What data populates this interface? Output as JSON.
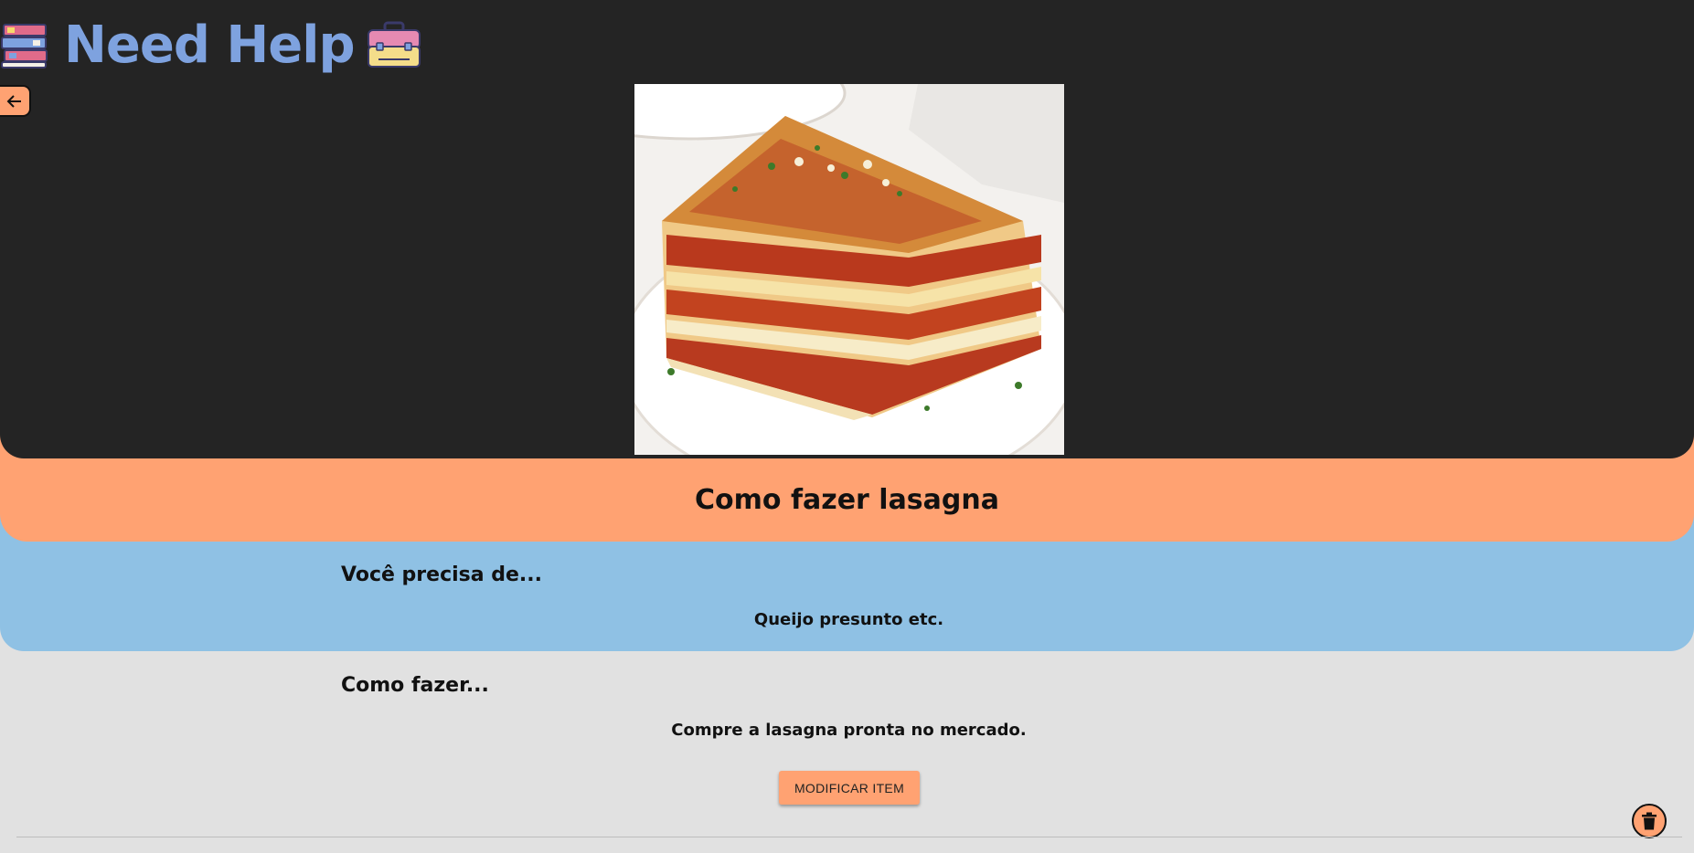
{
  "header": {
    "app_title": "Need Help",
    "logo_left_icon": "books-stack-icon",
    "logo_right_icon": "toolbox-icon",
    "back_icon": "arrow-left-icon"
  },
  "hero": {
    "image_subject": "lasagna-photo"
  },
  "item": {
    "title": "Como fazer lasagna",
    "needs_heading": "Você precisa de...",
    "needs_text": "Queijo presunto etc.",
    "how_heading": "Como fazer...",
    "how_text": "Compre a lasagna pronta no mercado."
  },
  "actions": {
    "modify_label": "MODIFICAR ITEM",
    "delete_icon": "trash-icon"
  },
  "colors": {
    "header_bg": "#242424",
    "accent_orange": "#ffa272",
    "accent_blue": "#8fc1e4",
    "title_blue": "#7ea2df",
    "page_bg": "#e1e1e1"
  }
}
